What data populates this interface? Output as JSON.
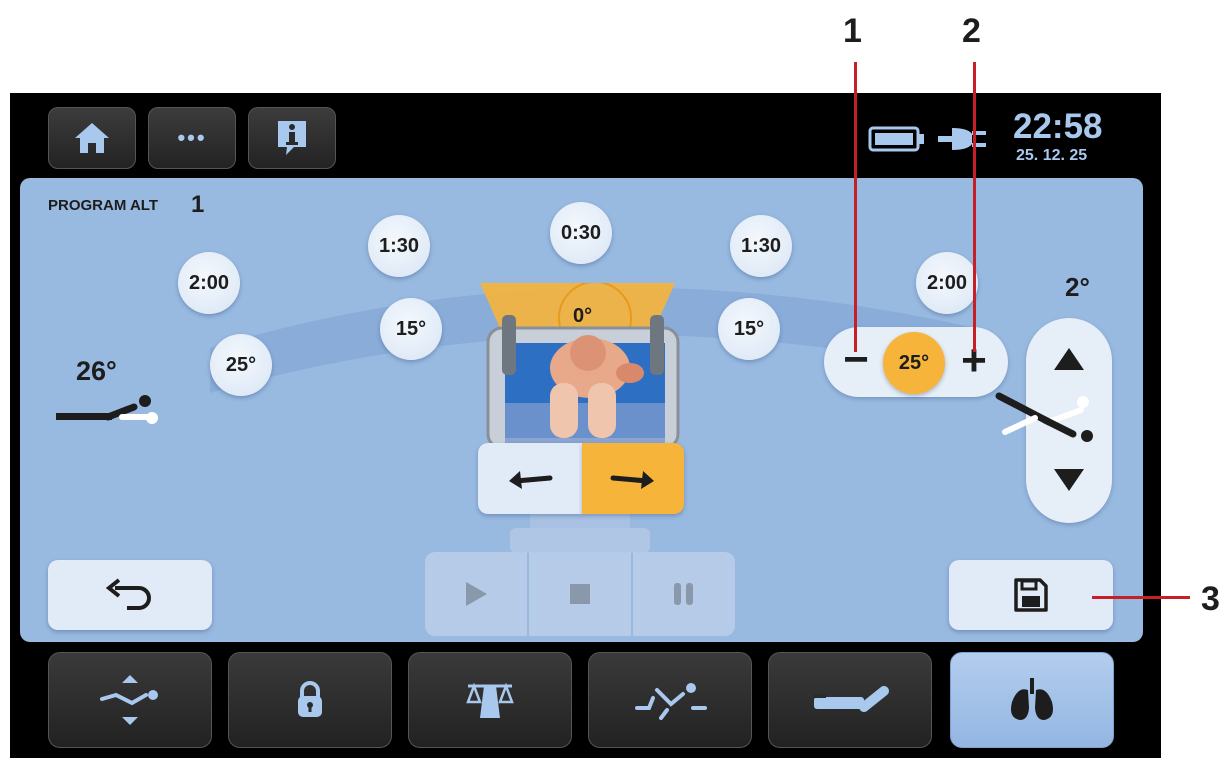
{
  "header": {
    "time": "22:58",
    "date": "25. 12. 25",
    "buttons": [
      {
        "icon": "home-icon"
      },
      {
        "icon": "more-icon",
        "label": "•••"
      },
      {
        "icon": "info-icon"
      }
    ],
    "status_icons": [
      "battery-icon",
      "plug-icon"
    ]
  },
  "program": {
    "title": "PROGRAM ALT",
    "number": "1"
  },
  "arc": {
    "times": [
      "2:00",
      "1:30",
      "0:30",
      "1:30",
      "2:00"
    ],
    "angles": [
      "25°",
      "15°",
      "0°",
      "15°"
    ]
  },
  "left_tilt": {
    "label": "26°"
  },
  "right_tilt": {
    "label": "2°"
  },
  "stepper": {
    "minus": "−",
    "plus": "+",
    "value": "25°"
  },
  "direction": {
    "left_icon": "arrow-left-icon",
    "right_icon": "arrow-right-icon",
    "selected": "right"
  },
  "playback": [
    "play-icon",
    "stop-icon",
    "pause-icon"
  ],
  "bottom_nav": [
    {
      "icon": "positions-icon"
    },
    {
      "icon": "lock-icon"
    },
    {
      "icon": "scale-icon"
    },
    {
      "icon": "exercise-icon"
    },
    {
      "icon": "bed-flat-icon"
    },
    {
      "icon": "lungs-icon",
      "active": true
    }
  ],
  "callouts": [
    "1",
    "2",
    "3"
  ],
  "colors": {
    "panel": "#98b9e0",
    "accent": "#f6b43a",
    "screen": "#000000",
    "clock": "#a8c8ee",
    "callout_line": "#c61f27"
  }
}
